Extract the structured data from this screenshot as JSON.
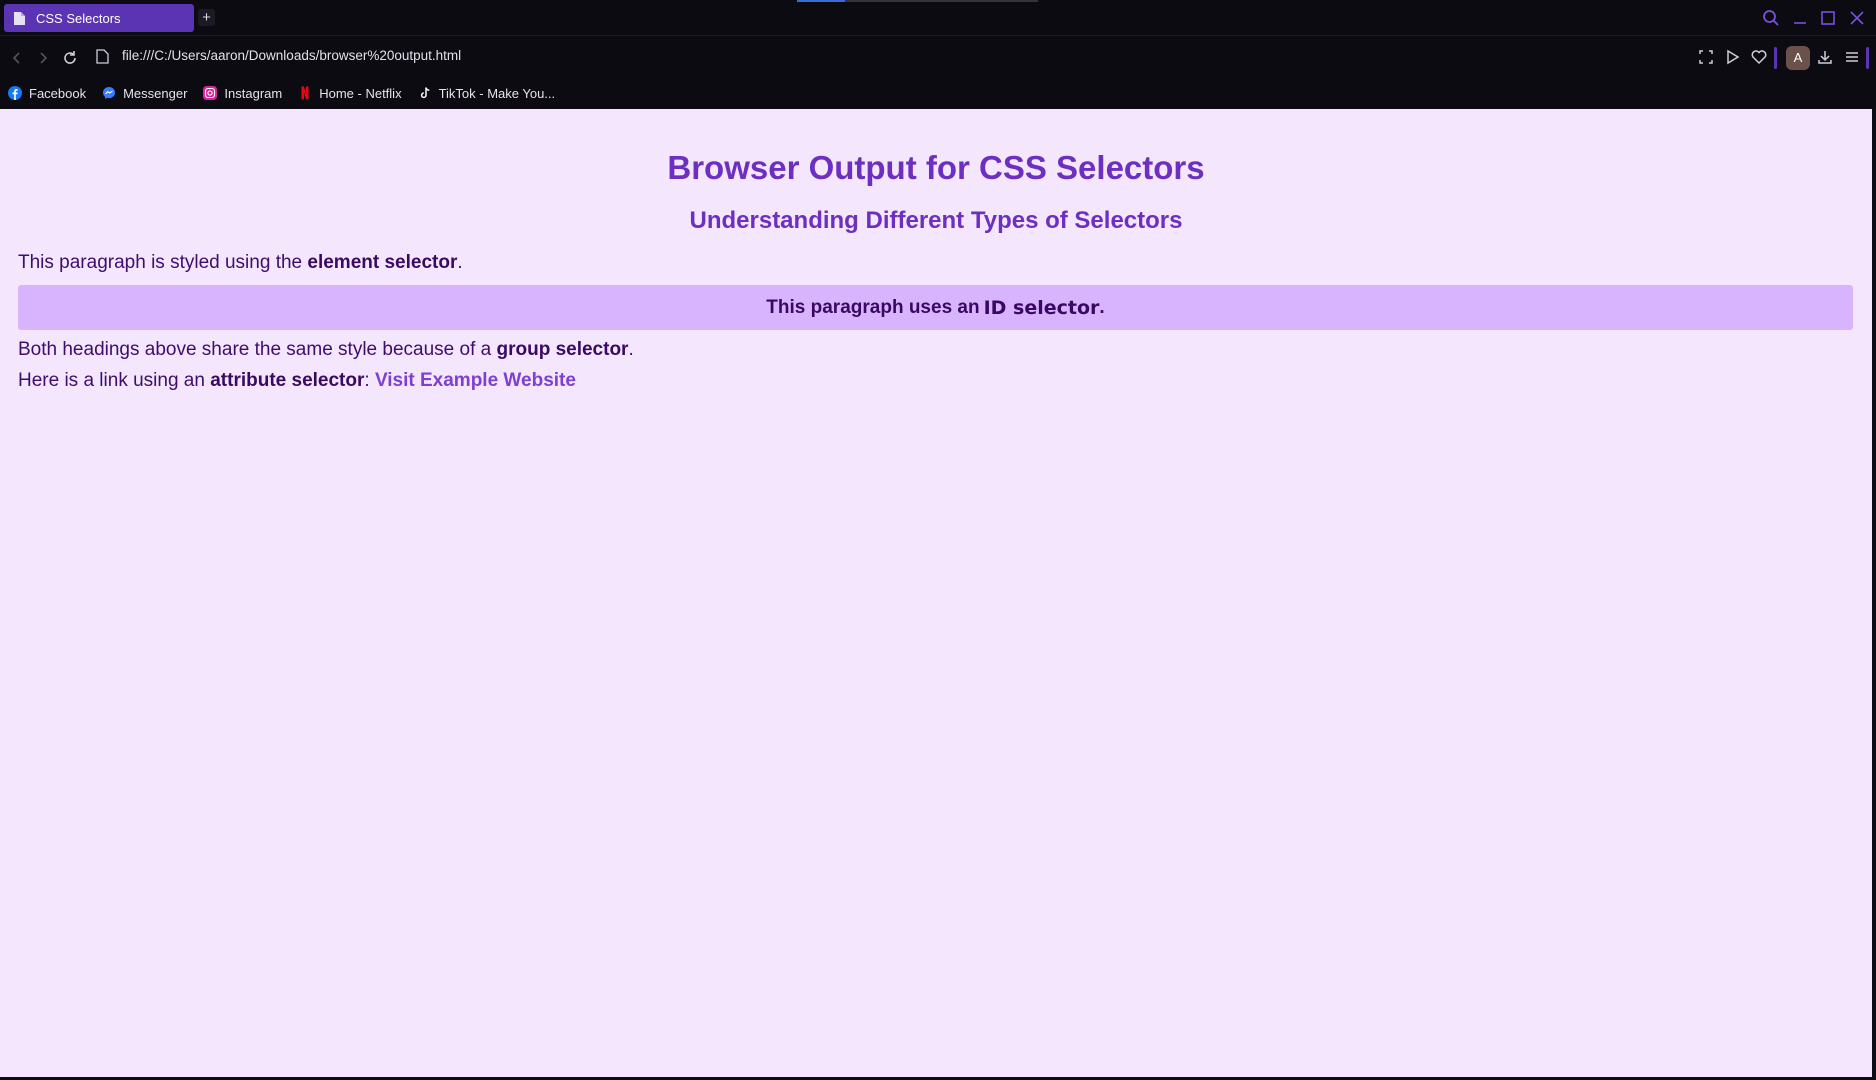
{
  "window": {
    "tab_title": "CSS Selectors",
    "new_tab_label": "+",
    "accent_color": "#5b34b4"
  },
  "toolbar": {
    "url": "file:///C:/Users/aaron/Downloads/browser%20output.html",
    "profile_initial": "A"
  },
  "bookmarks": [
    {
      "label": "Facebook",
      "icon": "facebook-icon"
    },
    {
      "label": "Messenger",
      "icon": "messenger-icon"
    },
    {
      "label": "Instagram",
      "icon": "instagram-icon"
    },
    {
      "label": "Home - Netflix",
      "icon": "netflix-icon"
    },
    {
      "label": "TikTok - Make You...",
      "icon": "tiktok-icon"
    }
  ],
  "page": {
    "background": "#f3e6fd",
    "heading1": "Browser Output for CSS Selectors",
    "heading2": "Understanding Different Types of Selectors",
    "p1": {
      "before": "This paragraph is styled using the ",
      "bold": "element selector",
      "after": "."
    },
    "p2": {
      "before": "This paragraph uses an ",
      "bold": "ID selector",
      "after": "."
    },
    "p3": {
      "before": "Both headings above share the same style because of a ",
      "bold": "group selector",
      "after": "."
    },
    "p4": {
      "before": "Here is a link using an ",
      "bold": "attribute selector",
      "mid": ": ",
      "link": "Visit Example Website"
    }
  }
}
